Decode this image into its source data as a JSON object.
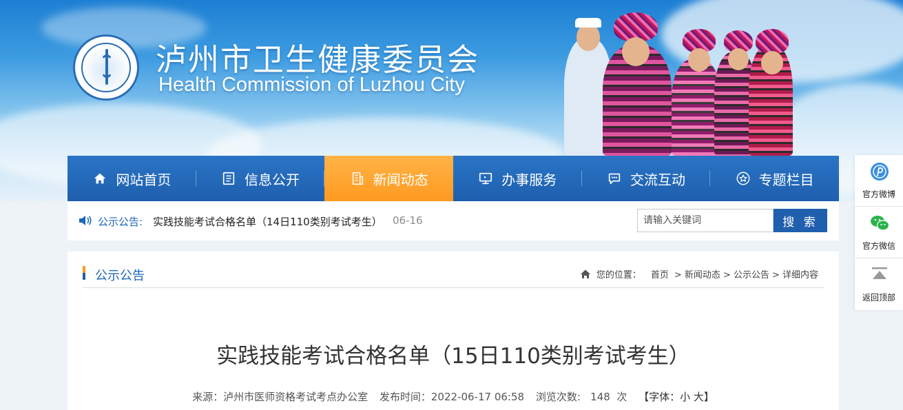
{
  "header": {
    "title_cn": "泸州市卫生健康委员会",
    "title_en": "Health Commission of Luzhou City",
    "logo_text": "Health Commission of Luzhou City"
  },
  "nav": {
    "items": [
      {
        "label": "网站首页",
        "icon": "home-icon"
      },
      {
        "label": "信息公开",
        "icon": "document-icon"
      },
      {
        "label": "新闻动态",
        "icon": "building-icon",
        "active": true
      },
      {
        "label": "办事服务",
        "icon": "monitor-icon"
      },
      {
        "label": "交流互动",
        "icon": "chat-icon"
      },
      {
        "label": "专题栏目",
        "icon": "star-icon"
      }
    ]
  },
  "notice": {
    "label": "公示公告:",
    "text": "实践技能考试合格名单（14日110类别考试考生）",
    "date": "06-16"
  },
  "search": {
    "placeholder": "请输入关键词",
    "button": "搜 索"
  },
  "section": {
    "title": "公示公告"
  },
  "breadcrumb": {
    "prefix": "您的位置：",
    "items": [
      "首页",
      "> 新闻动态",
      "> 公示公告",
      "> 详细内容"
    ]
  },
  "article": {
    "title": "实践技能考试合格名单（15日110类别考试考生）",
    "source": "来源：泸州市医师资格考试考点办公室",
    "published": "发布时间：2022-06-17 06:58",
    "views": "浏览次数:   148  次",
    "font_control": "【字体：小 大】"
  },
  "float_bar": {
    "items": [
      {
        "label": "官方微博",
        "icon": "weibo-icon"
      },
      {
        "label": "官方微信",
        "icon": "wechat-icon"
      },
      {
        "label": "返回顶部",
        "icon": "back-to-top-icon"
      }
    ]
  },
  "colors": {
    "nav_blue": "#1f5fae",
    "nav_active": "#ff9a1f",
    "link_blue": "#1c66b8"
  }
}
